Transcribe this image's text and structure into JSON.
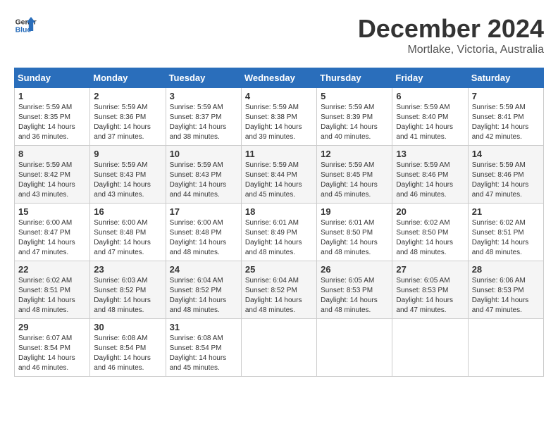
{
  "logo": {
    "line1": "General",
    "line2": "Blue"
  },
  "title": "December 2024",
  "subtitle": "Mortlake, Victoria, Australia",
  "headers": [
    "Sunday",
    "Monday",
    "Tuesday",
    "Wednesday",
    "Thursday",
    "Friday",
    "Saturday"
  ],
  "weeks": [
    [
      {
        "day": "1",
        "sunrise": "5:59 AM",
        "sunset": "8:35 PM",
        "daylight": "14 hours and 36 minutes."
      },
      {
        "day": "2",
        "sunrise": "5:59 AM",
        "sunset": "8:36 PM",
        "daylight": "14 hours and 37 minutes."
      },
      {
        "day": "3",
        "sunrise": "5:59 AM",
        "sunset": "8:37 PM",
        "daylight": "14 hours and 38 minutes."
      },
      {
        "day": "4",
        "sunrise": "5:59 AM",
        "sunset": "8:38 PM",
        "daylight": "14 hours and 39 minutes."
      },
      {
        "day": "5",
        "sunrise": "5:59 AM",
        "sunset": "8:39 PM",
        "daylight": "14 hours and 40 minutes."
      },
      {
        "day": "6",
        "sunrise": "5:59 AM",
        "sunset": "8:40 PM",
        "daylight": "14 hours and 41 minutes."
      },
      {
        "day": "7",
        "sunrise": "5:59 AM",
        "sunset": "8:41 PM",
        "daylight": "14 hours and 42 minutes."
      }
    ],
    [
      {
        "day": "8",
        "sunrise": "5:59 AM",
        "sunset": "8:42 PM",
        "daylight": "14 hours and 43 minutes."
      },
      {
        "day": "9",
        "sunrise": "5:59 AM",
        "sunset": "8:43 PM",
        "daylight": "14 hours and 43 minutes."
      },
      {
        "day": "10",
        "sunrise": "5:59 AM",
        "sunset": "8:43 PM",
        "daylight": "14 hours and 44 minutes."
      },
      {
        "day": "11",
        "sunrise": "5:59 AM",
        "sunset": "8:44 PM",
        "daylight": "14 hours and 45 minutes."
      },
      {
        "day": "12",
        "sunrise": "5:59 AM",
        "sunset": "8:45 PM",
        "daylight": "14 hours and 45 minutes."
      },
      {
        "day": "13",
        "sunrise": "5:59 AM",
        "sunset": "8:46 PM",
        "daylight": "14 hours and 46 minutes."
      },
      {
        "day": "14",
        "sunrise": "5:59 AM",
        "sunset": "8:46 PM",
        "daylight": "14 hours and 47 minutes."
      }
    ],
    [
      {
        "day": "15",
        "sunrise": "6:00 AM",
        "sunset": "8:47 PM",
        "daylight": "14 hours and 47 minutes."
      },
      {
        "day": "16",
        "sunrise": "6:00 AM",
        "sunset": "8:48 PM",
        "daylight": "14 hours and 47 minutes."
      },
      {
        "day": "17",
        "sunrise": "6:00 AM",
        "sunset": "8:48 PM",
        "daylight": "14 hours and 48 minutes."
      },
      {
        "day": "18",
        "sunrise": "6:01 AM",
        "sunset": "8:49 PM",
        "daylight": "14 hours and 48 minutes."
      },
      {
        "day": "19",
        "sunrise": "6:01 AM",
        "sunset": "8:50 PM",
        "daylight": "14 hours and 48 minutes."
      },
      {
        "day": "20",
        "sunrise": "6:02 AM",
        "sunset": "8:50 PM",
        "daylight": "14 hours and 48 minutes."
      },
      {
        "day": "21",
        "sunrise": "6:02 AM",
        "sunset": "8:51 PM",
        "daylight": "14 hours and 48 minutes."
      }
    ],
    [
      {
        "day": "22",
        "sunrise": "6:02 AM",
        "sunset": "8:51 PM",
        "daylight": "14 hours and 48 minutes."
      },
      {
        "day": "23",
        "sunrise": "6:03 AM",
        "sunset": "8:52 PM",
        "daylight": "14 hours and 48 minutes."
      },
      {
        "day": "24",
        "sunrise": "6:04 AM",
        "sunset": "8:52 PM",
        "daylight": "14 hours and 48 minutes."
      },
      {
        "day": "25",
        "sunrise": "6:04 AM",
        "sunset": "8:52 PM",
        "daylight": "14 hours and 48 minutes."
      },
      {
        "day": "26",
        "sunrise": "6:05 AM",
        "sunset": "8:53 PM",
        "daylight": "14 hours and 48 minutes."
      },
      {
        "day": "27",
        "sunrise": "6:05 AM",
        "sunset": "8:53 PM",
        "daylight": "14 hours and 47 minutes."
      },
      {
        "day": "28",
        "sunrise": "6:06 AM",
        "sunset": "8:53 PM",
        "daylight": "14 hours and 47 minutes."
      }
    ],
    [
      {
        "day": "29",
        "sunrise": "6:07 AM",
        "sunset": "8:54 PM",
        "daylight": "14 hours and 46 minutes."
      },
      {
        "day": "30",
        "sunrise": "6:08 AM",
        "sunset": "8:54 PM",
        "daylight": "14 hours and 46 minutes."
      },
      {
        "day": "31",
        "sunrise": "6:08 AM",
        "sunset": "8:54 PM",
        "daylight": "14 hours and 45 minutes."
      },
      null,
      null,
      null,
      null
    ]
  ]
}
